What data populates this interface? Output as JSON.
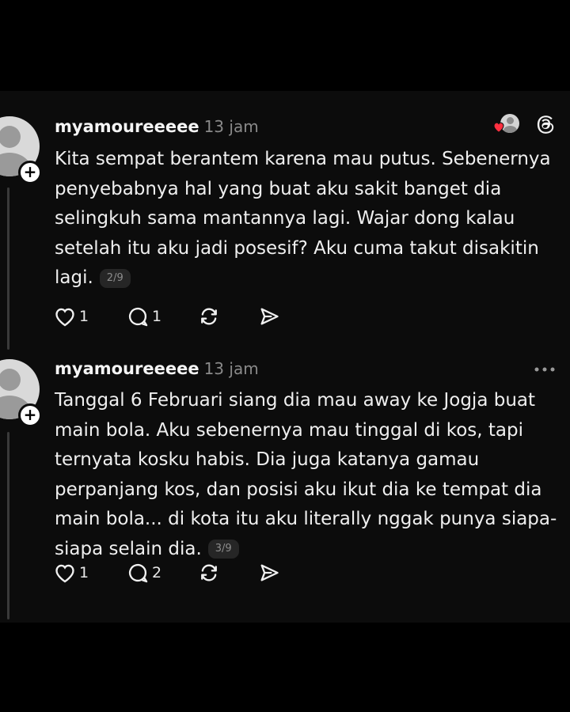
{
  "posts": [
    {
      "username": "myamoureeeee",
      "time": "13 jam",
      "text": "Kita sempat berantem karena mau putus. Sebenernya penyebabnya hal yang buat aku sakit banget dia selingkuh sama mantannya lagi. Wajar dong kalau setelah itu aku jadi posesif? Aku cuma takut disakitin lagi.",
      "page": "2/9",
      "likes": "1",
      "replies": "1"
    },
    {
      "username": "myamoureeeee",
      "time": "13 jam",
      "text": "Tanggal 6 Februari siang dia mau away ke Jogja buat main bola. Aku sebenernya mau tinggal di kos, tapi ternyata kosku habis. Dia juga katanya gamau perpanjang kos, dan posisi aku ikut dia ke tempat dia main bola... di kota itu aku literally nggak punya siapa-siapa selain dia.",
      "page": "3/9",
      "likes": "1",
      "replies": "2"
    }
  ],
  "icons": {
    "like": "heart-outline-icon",
    "reply": "speech-bubble-icon",
    "repost": "repost-arrows-icon",
    "share": "send-icon",
    "threads": "threads-logo-icon",
    "more": "more-dots-icon"
  },
  "colors": {
    "background": "#000000",
    "panel": "#0c0c0c",
    "text": "#efefef",
    "muted": "#8a8a8a",
    "heart_badge": "#ff3040"
  }
}
